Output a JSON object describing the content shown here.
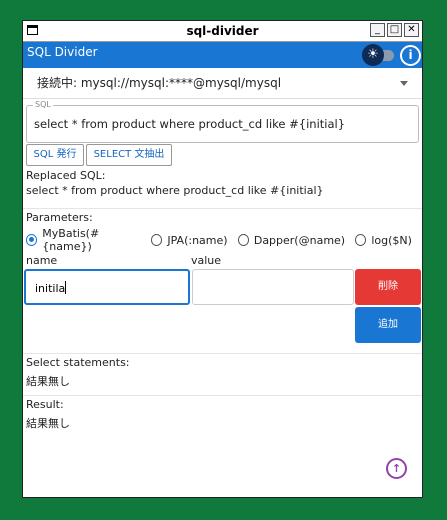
{
  "window": {
    "title": "sql-divider",
    "min": "_",
    "max": "□",
    "close": "✕"
  },
  "appbar": {
    "title": "SQL Divider",
    "sun_icon": "☀",
    "info_icon": "i"
  },
  "connection": {
    "value": "接続中: mysql://mysql:****@mysql/mysql"
  },
  "sql": {
    "legend": "SQL",
    "value": "select * from product where product_cd like #{initial}"
  },
  "buttons": {
    "issue": "SQL 発行",
    "extract": "SELECT 文抽出",
    "delete": "削除",
    "add": "追加"
  },
  "replaced": {
    "label": "Replaced SQL:",
    "value": "select * from product where product_cd like #{initial}"
  },
  "params": {
    "label": "Parameters:",
    "options": [
      "MyBatis(#{name})",
      "JPA(:name)",
      "Dapper(@name)",
      "log($N)"
    ],
    "selected": 0,
    "name_label": "name",
    "value_label": "value",
    "name_value": "initila",
    "value_value": ""
  },
  "select_statements": {
    "label": "Select statements:",
    "value": "結果無し"
  },
  "result": {
    "label": "Result:",
    "value": "結果無し"
  },
  "scroll_up_icon": "↑"
}
